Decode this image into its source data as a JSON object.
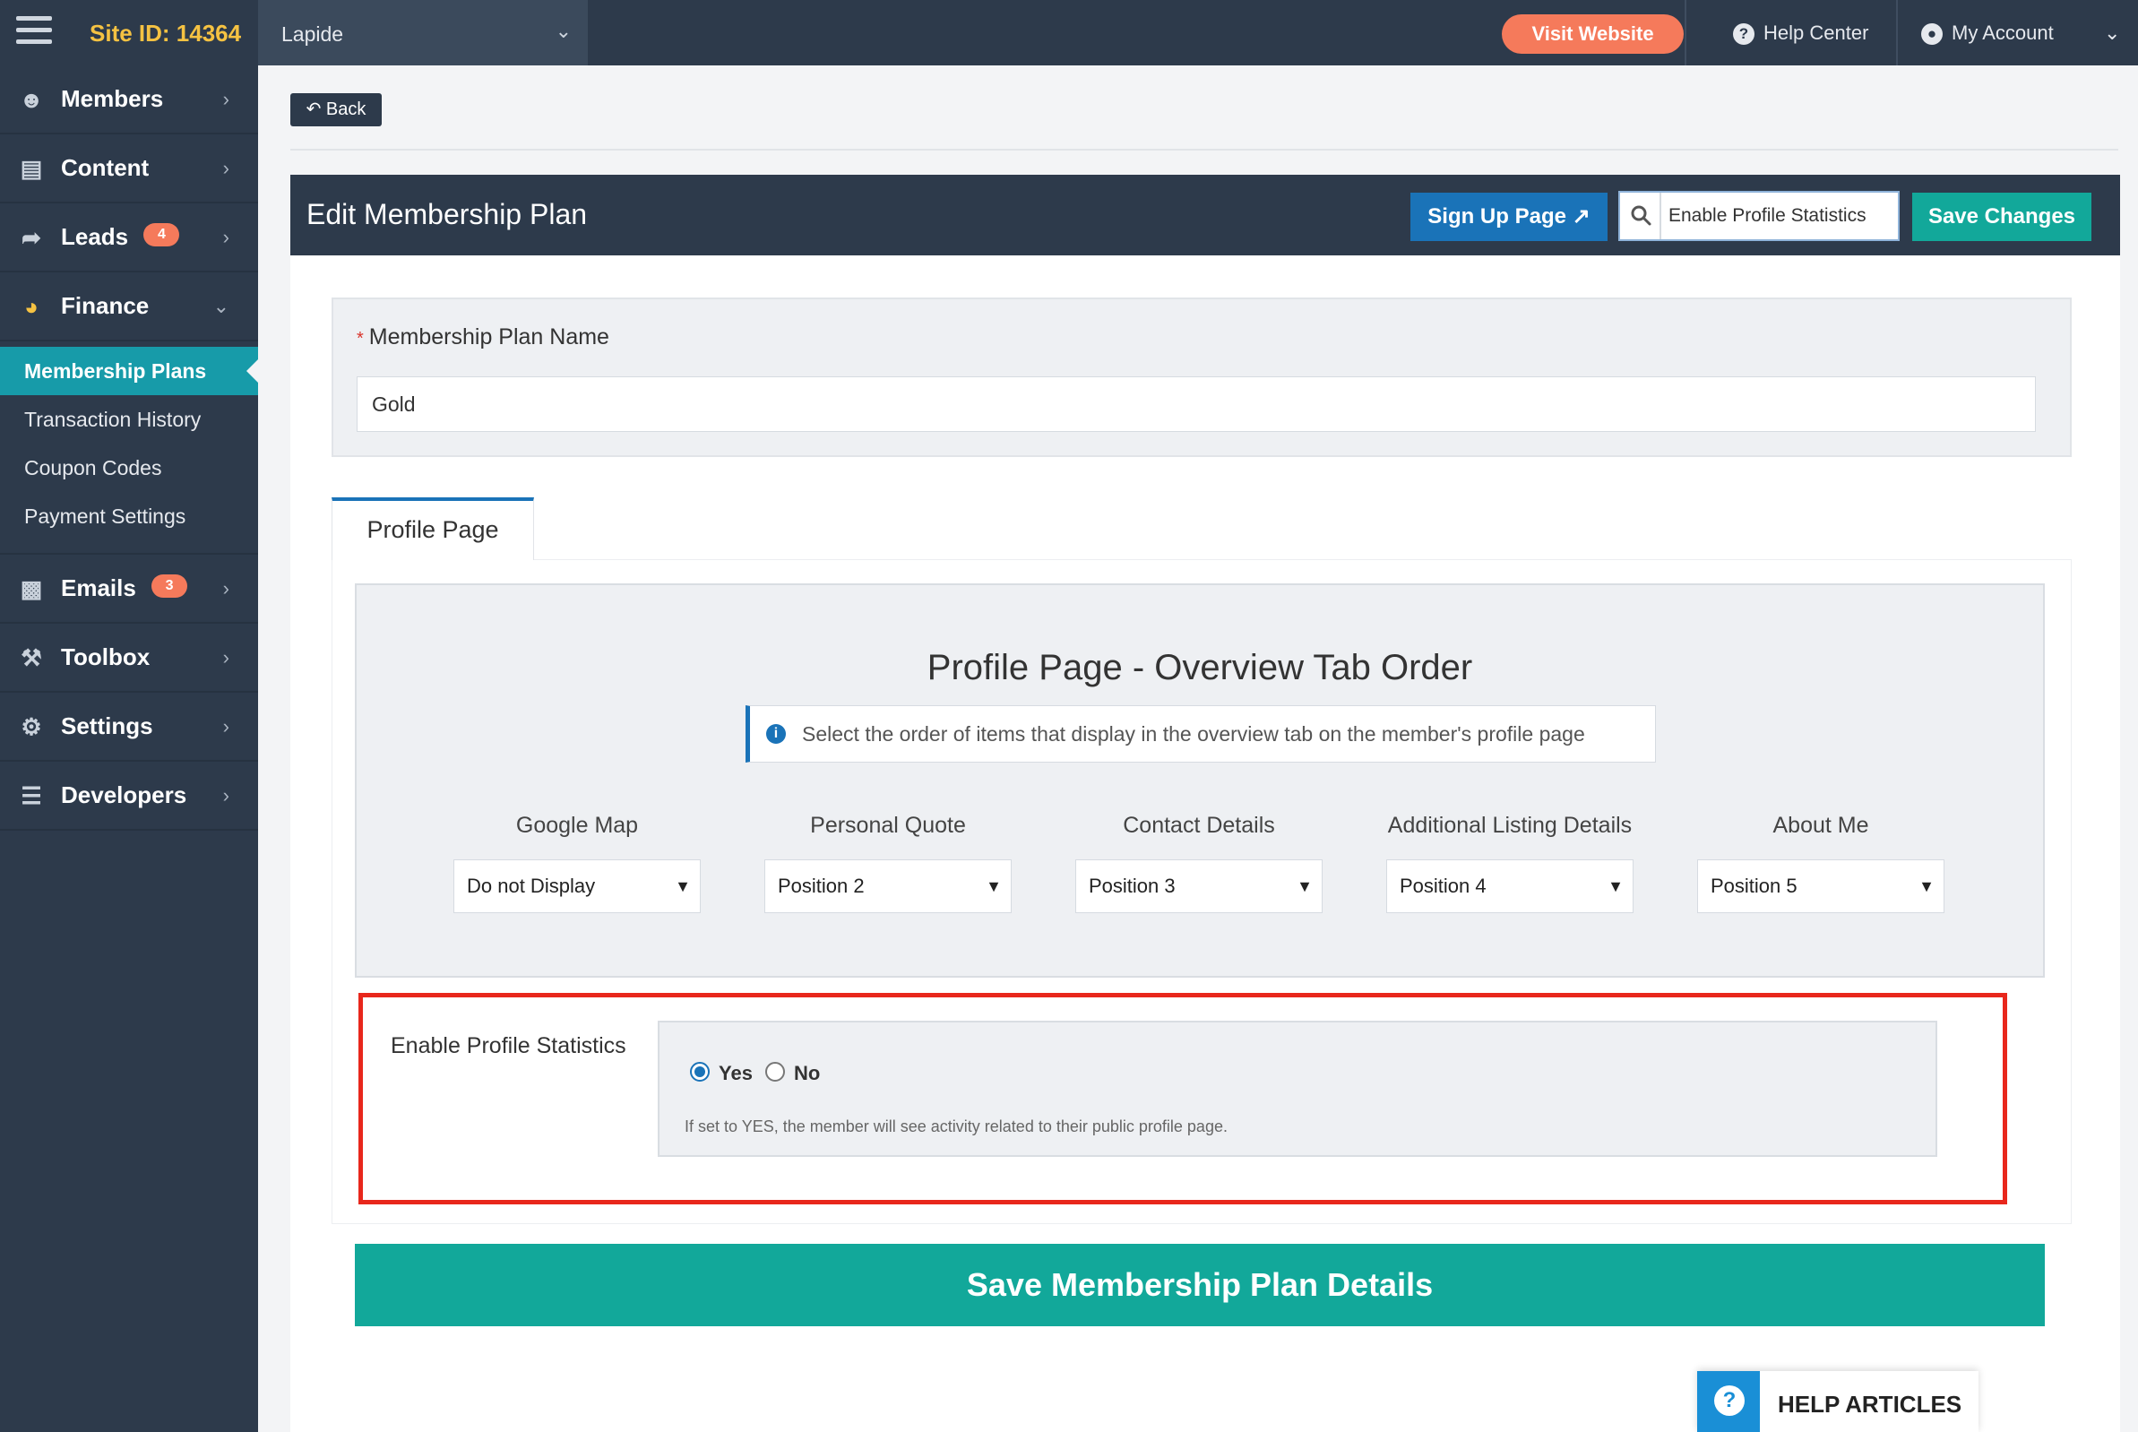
{
  "topbar": {
    "site_id": "Site ID: 14364",
    "site_name": "Lapide",
    "visit_website": "Visit Website",
    "help_center": "Help Center",
    "my_account": "My Account"
  },
  "sidebar": {
    "items": [
      {
        "label": "Members",
        "icon": "users-icon"
      },
      {
        "label": "Content",
        "icon": "folder-icon"
      },
      {
        "label": "Leads",
        "icon": "share-icon",
        "badge": "4"
      },
      {
        "label": "Finance",
        "icon": "pie-chart-icon"
      },
      {
        "label": "Emails",
        "icon": "inbox-icon",
        "badge": "3"
      },
      {
        "label": "Toolbox",
        "icon": "wrench-icon"
      },
      {
        "label": "Settings",
        "icon": "gear-icon"
      },
      {
        "label": "Developers",
        "icon": "sliders-icon"
      }
    ],
    "finance_sub": [
      "Membership Plans",
      "Transaction History",
      "Coupon Codes",
      "Payment Settings"
    ]
  },
  "back_label": "Back",
  "panel": {
    "title": "Edit Membership Plan",
    "signup_label": "Sign Up Page",
    "search_value": "Enable Profile Statistics",
    "save_label": "Save Changes"
  },
  "plan_name": {
    "label": "Membership Plan Name",
    "value": "Gold"
  },
  "tab_label": "Profile Page",
  "overview": {
    "title": "Profile Page - Overview Tab Order",
    "note": "Select the order of items that display in the overview tab on the member's profile page",
    "columns": [
      {
        "label": "Google Map",
        "value": "Do not Display"
      },
      {
        "label": "Personal Quote",
        "value": "Position 2"
      },
      {
        "label": "Contact Details",
        "value": "Position 3"
      },
      {
        "label": "Additional Listing Details",
        "value": "Position 4"
      },
      {
        "label": "About Me",
        "value": "Position 5"
      }
    ]
  },
  "stats": {
    "label": "Enable Profile Statistics",
    "yes": "Yes",
    "no": "No",
    "selected": "Yes",
    "help": "If set to YES, the member will see activity related to their public profile page."
  },
  "save_plan_label": "Save Membership Plan Details",
  "help_articles": "HELP ARTICLES",
  "colors": {
    "navy": "#2d3a4b",
    "teal": "#12a89a",
    "blue": "#1a73b8",
    "orange": "#f57a5b",
    "highlight_red": "#e8271c"
  }
}
